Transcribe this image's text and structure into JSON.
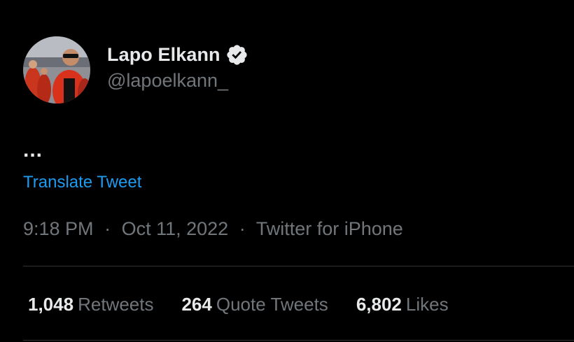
{
  "user": {
    "display_name": "Lapo Elkann",
    "handle": "@lapoelkann_",
    "verified": true
  },
  "tweet": {
    "text": "...",
    "translate_label": "Translate Tweet"
  },
  "meta": {
    "time": "9:18 PM",
    "separator": "·",
    "date": "Oct 11, 2022",
    "source": "Twitter for iPhone"
  },
  "stats": {
    "retweets": {
      "count": "1,048",
      "label": "Retweets"
    },
    "quote_tweets": {
      "count": "264",
      "label": "Quote Tweets"
    },
    "likes": {
      "count": "6,802",
      "label": "Likes"
    }
  },
  "colors": {
    "background": "#000000",
    "primary_text": "#e7e9ea",
    "secondary_text": "#71767b",
    "link": "#1d9bf0",
    "divider": "#2f3336"
  },
  "icons": {
    "verified": "verified-badge-icon"
  }
}
